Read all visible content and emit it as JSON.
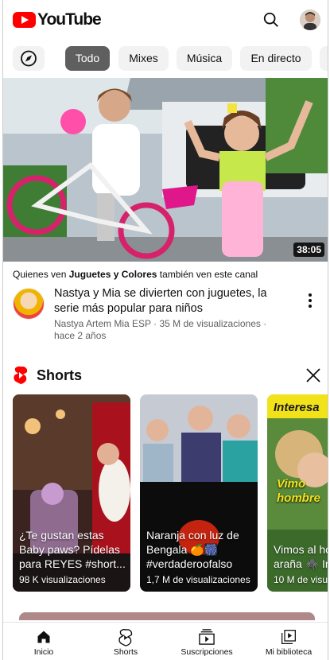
{
  "header": {
    "logo_text": "YouTube"
  },
  "chips": [
    {
      "label": ""
    },
    {
      "label": "Todo"
    },
    {
      "label": "Mixes"
    },
    {
      "label": "Música"
    },
    {
      "label": "En directo"
    }
  ],
  "video": {
    "duration": "38:05",
    "context_prefix": "Quienes ven ",
    "context_channel": "Juguetes y Colores",
    "context_suffix": " también ven este canal",
    "title": "Nastya y Mia se divierten con juguetes, la serie más popular para niños",
    "channel": "Nastya Artem Mia ESP",
    "views_age": "35 M de visualizaciones · hace 2 años"
  },
  "shorts": {
    "title": "Shorts",
    "items": [
      {
        "caption": "¿Te gustan estas Baby paws? Pídelas para REYES #short...",
        "views": "98 K visualizaciones"
      },
      {
        "caption": "Naranja con luz de Bengala 🍊🎆 #verdaderoofalso",
        "views": "1,7 M de visualizaciones"
      },
      {
        "caption": "Vimos al hombre araña 🕷️ Interesante",
        "views": "10 M de visualizaciones",
        "overlay_top": "Interesa",
        "overlay_mid": "Vimo hombre"
      }
    ]
  },
  "nav": [
    {
      "label": "Inicio"
    },
    {
      "label": "Shorts"
    },
    {
      "label": "Suscripciones"
    },
    {
      "label": "Mi biblioteca"
    }
  ],
  "colors": {
    "brand": "#ff0000",
    "chip_active": "#5f5f5f",
    "chip": "#f2f2f2",
    "meta_text": "#606060"
  }
}
